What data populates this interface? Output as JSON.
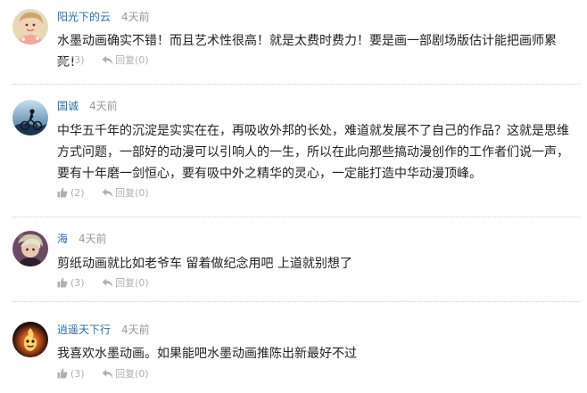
{
  "comments": [
    {
      "user": "阳光下的云",
      "time": "4天前",
      "text": "水墨动画确实不错！而且艺术性很高！就是太费时费力！要是画一部剧场版估计能把画师累死！",
      "likes": "(3)",
      "reply_label": "回复",
      "replies": "(0)"
    },
    {
      "user": "国诚",
      "time": "4天前",
      "text": "中华五千年的沉淀是实实在在，再吸收外邦的长处，难道就发展不了自己的作品？这就是思维方式问题，一部好的动漫可以引响人的一生，所以在此向那些搞动漫创作的工作者们说一声，要有十年磨一剑恒心，要有吸中外之精华的灵心，一定能打造中华动漫顶峰。",
      "likes": "(2)",
      "reply_label": "回复",
      "replies": "(0)"
    },
    {
      "user": "海",
      "time": "4天前",
      "text": "剪纸动画就比如老爷车  留着做纪念用吧  上道就别想了",
      "likes": "(3)",
      "reply_label": "回复",
      "replies": "(0)"
    },
    {
      "user": "逍遥天下行",
      "time": "4天前",
      "text": "我喜欢水墨动画。如果能吧水墨动画推陈出新最好不过",
      "likes": "(3)",
      "reply_label": "回复",
      "replies": "(0)"
    }
  ],
  "icons": {
    "like": "thumbs-up-icon",
    "reply": "reply-arrow-icon"
  },
  "colors": {
    "username": "#2b6dad",
    "timestamp": "#999999",
    "action": "#b0b0b0",
    "divider": "#cfcfcf"
  }
}
